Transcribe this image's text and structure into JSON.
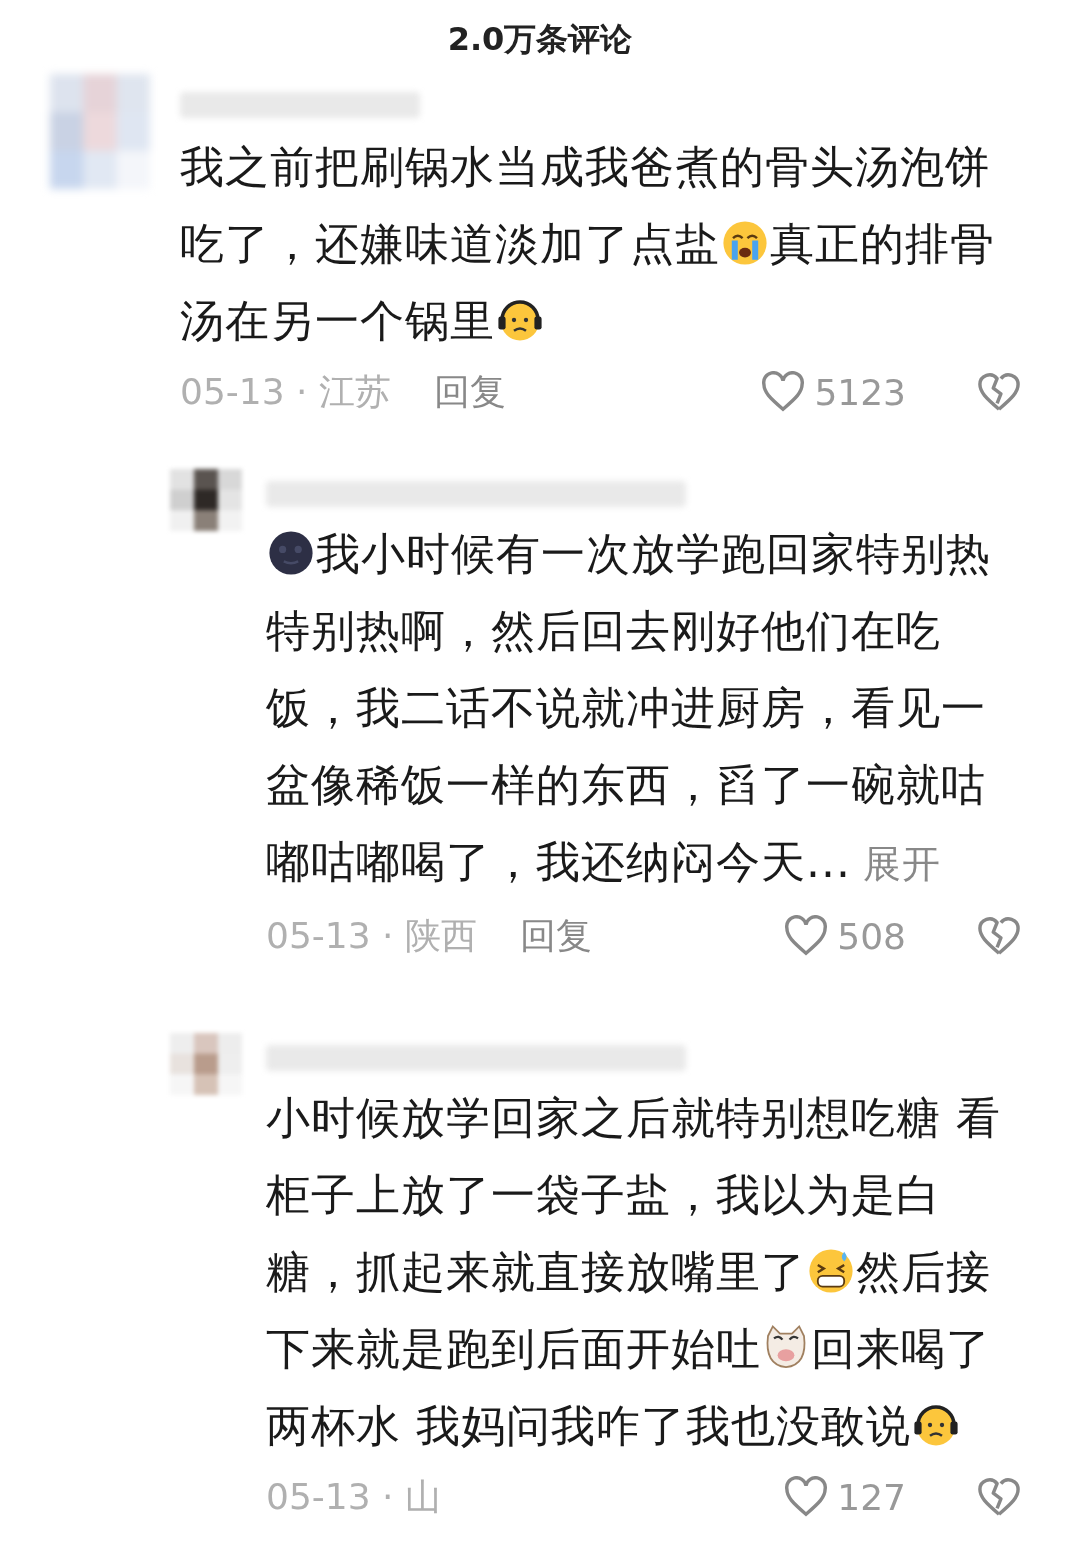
{
  "header": {
    "title": "2.0万条评论"
  },
  "comments": [
    {
      "segments": [
        {
          "kind": "text",
          "text": "我之前把刷锅水当成我爸煮的骨头汤泡饼吃了，还嫌味道淡加了点盐"
        },
        {
          "kind": "crying"
        },
        {
          "kind": "text",
          "text": "真正的排骨汤在另一个锅里"
        },
        {
          "kind": "headphones"
        }
      ],
      "date": "05-13 · 江苏",
      "reply_label": "回复",
      "likes": "5123",
      "replies": [
        {
          "segments": [
            {
              "kind": "moon"
            },
            {
              "kind": "text",
              "text": "我小时候有一次放学跑回家特别热特别热啊，然后回去刚好他们在吃饭，我二话不说就冲进厨房，看见一盆像稀饭一样的东西，舀了一碗就咕嘟咕嘟喝了，我还纳闷今天..."
            }
          ],
          "more": "展开",
          "date": "05-13 · 陕西",
          "reply_label": "回复",
          "likes": "508"
        },
        {
          "segments": [
            {
              "kind": "text",
              "text": "小时候放学回家之后就特别想吃糖 看柜子上放了一袋子盐，我以为是白糖，抓起来就直接放嘴里了"
            },
            {
              "kind": "grin-sweat"
            },
            {
              "kind": "text",
              "text": "然后接下来就是跑到后面开始吐"
            },
            {
              "kind": "cat"
            },
            {
              "kind": "text",
              "text": "回来喝了两杯水 我妈问我咋了我也没敢说"
            },
            {
              "kind": "headphones"
            }
          ],
          "date": "05-13 · 山",
          "likes": "127"
        }
      ]
    }
  ]
}
